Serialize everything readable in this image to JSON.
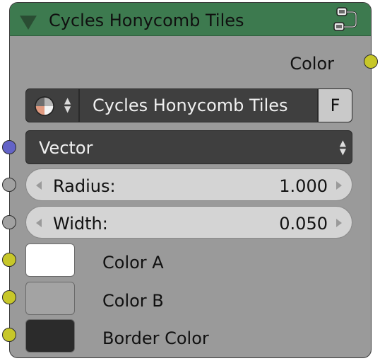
{
  "node": {
    "title": "Cycles Honycomb Tiles",
    "header_color": "#3d7a4f",
    "output_label": "Color",
    "texture_name": "Cycles Honycomb Tiles",
    "fake_user_label": "F",
    "vector_label": "Vector",
    "radius": {
      "label": "Radius:",
      "value": "1.000"
    },
    "width": {
      "label": "Width:",
      "value": "0.050"
    },
    "color_a": {
      "label": "Color A",
      "swatch": "#ffffff"
    },
    "color_b": {
      "label": "Color B",
      "swatch": "#a3a3a3"
    },
    "border_color": {
      "label": "Border Color",
      "swatch": "#2b2b2b"
    },
    "socket_colors": {
      "color": "#c7c729",
      "vector": "#6363c7",
      "float": "#a1a1a1"
    },
    "icons": [
      "collapse-triangle-icon",
      "node-group-icon",
      "texture-preview-icon",
      "up-down-arrows-icon",
      "left-arrow-icon",
      "right-arrow-icon"
    ]
  }
}
